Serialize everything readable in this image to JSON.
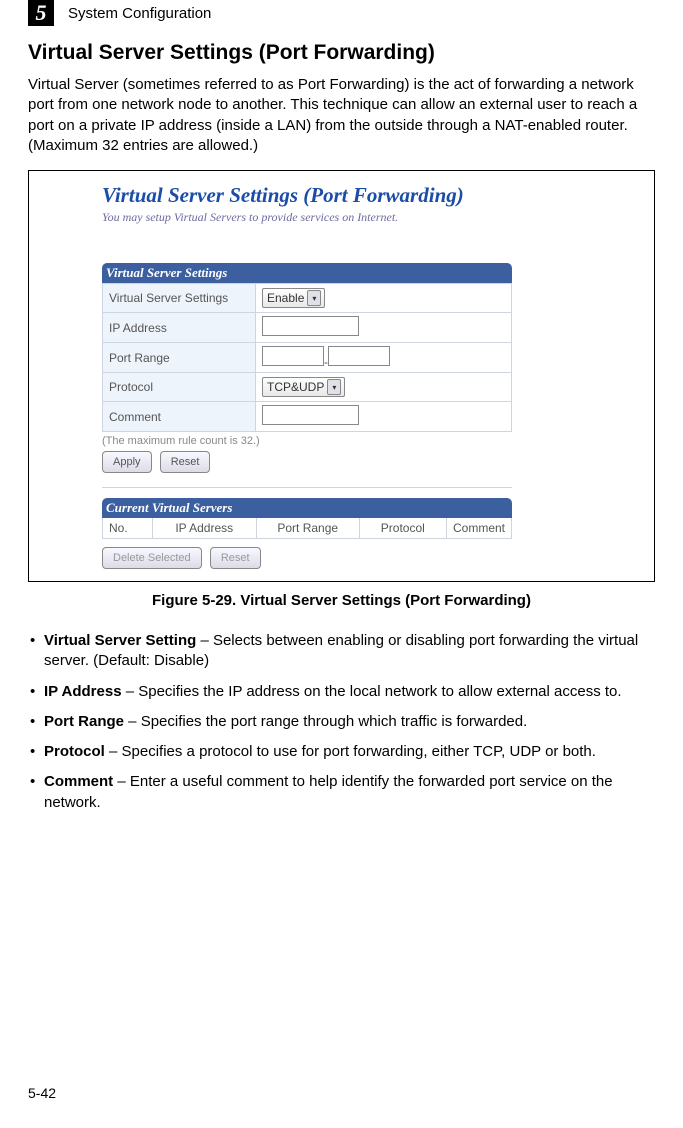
{
  "chapter": {
    "number": "5",
    "title": "System Configuration"
  },
  "section": {
    "title": "Virtual Server Settings (Port Forwarding)",
    "paragraph": "Virtual Server (sometimes referred to as Port Forwarding) is the act of forwarding a network port from one network node to another. This technique can allow an external user to reach a port on a private IP address (inside a LAN) from the outside through a NAT-enabled router. (Maximum 32 entries are allowed.)"
  },
  "figure": {
    "title": "Virtual Server Settings (Port Forwarding)",
    "subtitle": "You may setup Virtual Servers to provide services on Internet.",
    "panel1": "Virtual Server Settings",
    "rows": {
      "vss_label": "Virtual Server Settings",
      "vss_value": "Enable",
      "ip_label": "IP Address",
      "pr_label": "Port Range",
      "pr_sep": "-",
      "proto_label": "Protocol",
      "proto_value": "TCP&UDP",
      "comment_label": "Comment"
    },
    "note": "(The maximum rule count is 32.)",
    "apply": "Apply",
    "reset": "Reset",
    "panel2": "Current Virtual Servers",
    "headers": {
      "no": "No.",
      "ip": "IP Address",
      "pr": "Port Range",
      "proto": "Protocol",
      "comment": "Comment"
    },
    "delete": "Delete Selected",
    "reset2": "Reset",
    "caption": "Figure 5-29.   Virtual Server Settings (Port Forwarding)"
  },
  "bullets": [
    {
      "term": "Virtual Server Setting",
      "desc": " – Selects between enabling or disabling port forwarding the virtual server. (Default: Disable)"
    },
    {
      "term": "IP Address",
      "desc": " – Specifies the IP address on the local network to allow external access to."
    },
    {
      "term": "Port Range",
      "desc": " – Specifies the port range through which traffic is forwarded."
    },
    {
      "term": "Protocol",
      "desc": " – Specifies a protocol to use for port forwarding, either TCP, UDP or both."
    },
    {
      "term": "Comment",
      "desc": " – Enter a useful comment to help identify the forwarded port service on the network."
    }
  ],
  "footer": "5-42"
}
